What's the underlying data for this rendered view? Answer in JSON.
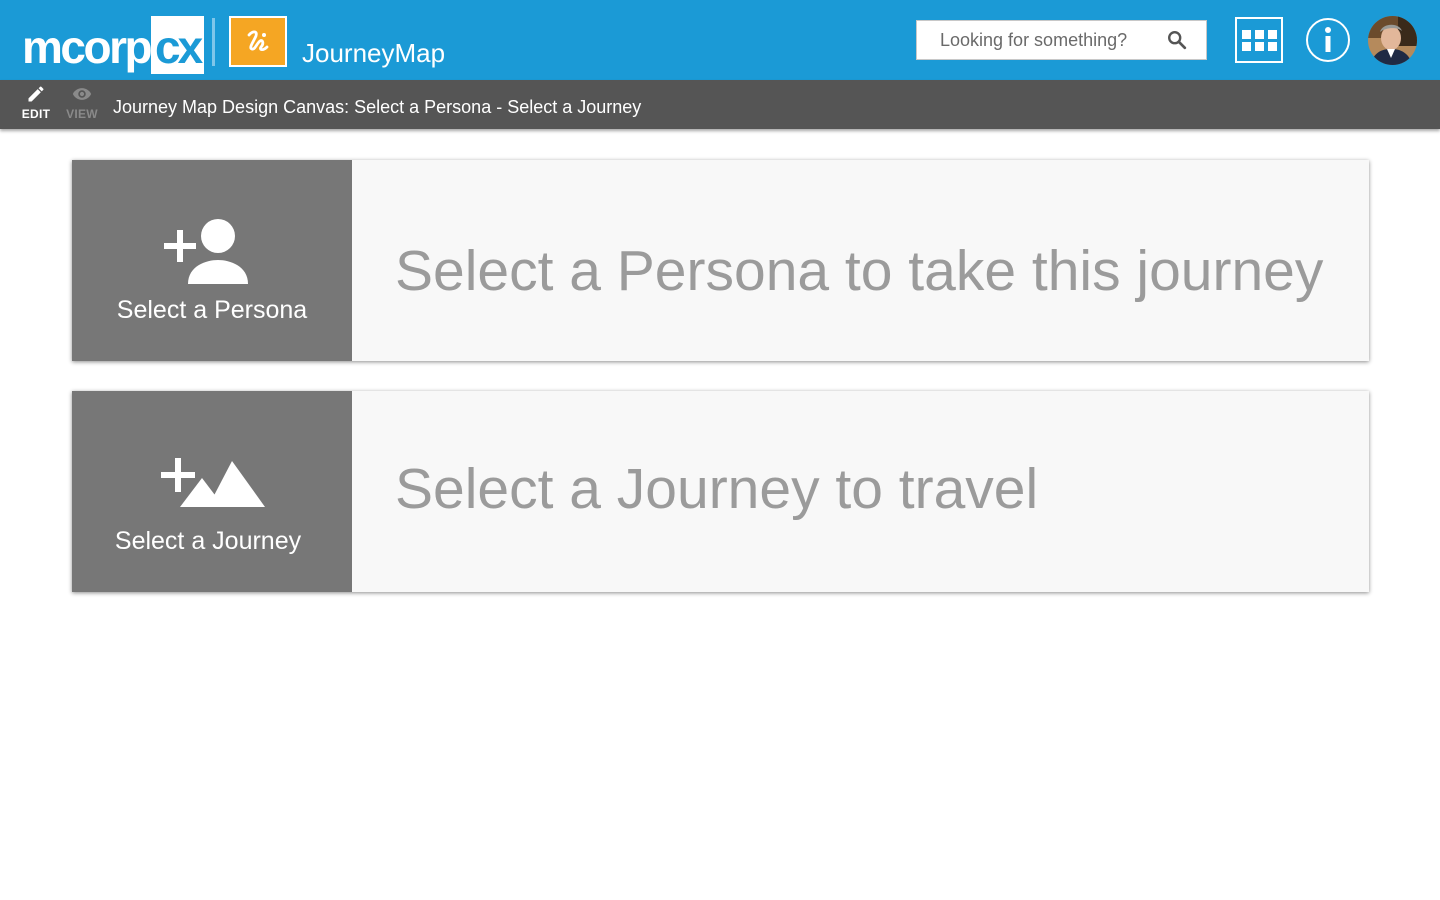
{
  "header": {
    "logo_text": "mcorp",
    "logo_cx": "cx",
    "app_name": "JourneyMap",
    "background_color": "#1b9ad6",
    "app_icon_color": "#f5a623",
    "search": {
      "placeholder": "Looking for something?",
      "value": ""
    },
    "icons": {
      "search": "search-icon",
      "apps": "apps-grid-icon",
      "info": "info-icon",
      "avatar": "user-avatar"
    }
  },
  "toolbar": {
    "edit_label": "EDIT",
    "view_label": "VIEW",
    "canvas_title": "Journey Map Design Canvas: Select a Persona - Select a Journey",
    "background_color": "#555555"
  },
  "cards": {
    "persona": {
      "button_label": "Select a Persona",
      "prompt": "Select a Persona to take this journey",
      "icon": "add-person-icon"
    },
    "journey": {
      "button_label": "Select a Journey",
      "prompt": "Select a Journey to travel",
      "icon": "add-landscape-icon"
    }
  }
}
